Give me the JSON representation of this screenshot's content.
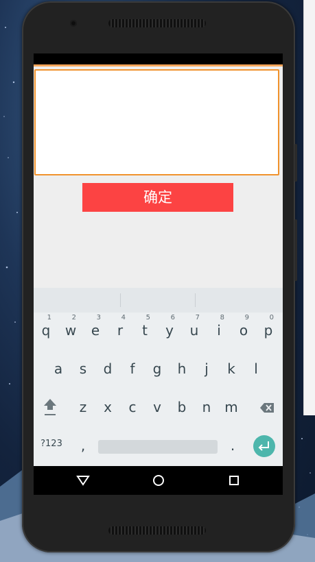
{
  "app": {
    "text_input_value": "",
    "confirm_label": "确定"
  },
  "keyboard": {
    "row1": [
      {
        "key": "q",
        "hint": "1"
      },
      {
        "key": "w",
        "hint": "2"
      },
      {
        "key": "e",
        "hint": "3"
      },
      {
        "key": "r",
        "hint": "4"
      },
      {
        "key": "t",
        "hint": "5"
      },
      {
        "key": "y",
        "hint": "6"
      },
      {
        "key": "u",
        "hint": "7"
      },
      {
        "key": "i",
        "hint": "8"
      },
      {
        "key": "o",
        "hint": "9"
      },
      {
        "key": "p",
        "hint": "0"
      }
    ],
    "row2": [
      "a",
      "s",
      "d",
      "f",
      "g",
      "h",
      "j",
      "k",
      "l"
    ],
    "row3": [
      "z",
      "x",
      "c",
      "v",
      "b",
      "n",
      "m"
    ],
    "symbols_label": "?123",
    "comma_label": ",",
    "period_label": ".",
    "accent_color": "#4db6ac"
  },
  "colors": {
    "button": "#fc4343",
    "input_border": "#f0922c",
    "app_background": "#eeeeee"
  },
  "nav": {
    "icons": [
      "back-icon",
      "home-icon",
      "recents-icon"
    ]
  }
}
